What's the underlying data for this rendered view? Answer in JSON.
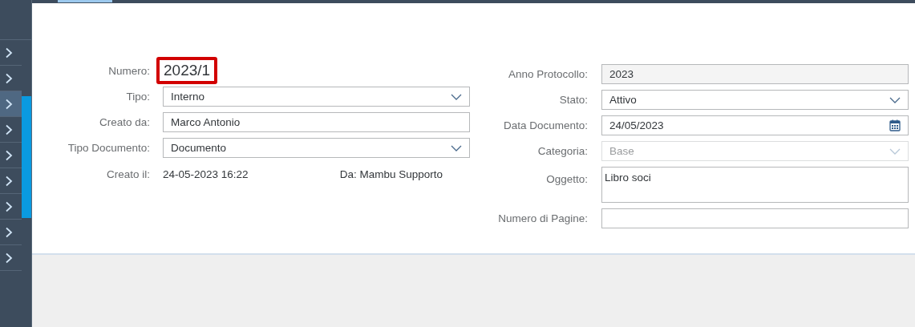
{
  "sidebar": {
    "items": [
      {
        "selected": false
      },
      {
        "selected": false
      },
      {
        "selected": true
      },
      {
        "selected": false
      },
      {
        "selected": false
      },
      {
        "selected": false
      },
      {
        "selected": false
      },
      {
        "selected": false
      },
      {
        "selected": false
      }
    ]
  },
  "form_left": [
    {
      "label": "Numero:",
      "kind": "number",
      "value": "2023/1",
      "highlighted": true
    },
    {
      "label": "Tipo:",
      "kind": "select",
      "value": "Interno"
    },
    {
      "label": "Creato da:",
      "kind": "text",
      "value": "Marco Antonio"
    },
    {
      "label": "Tipo Documento:",
      "kind": "select",
      "value": "Documento"
    },
    {
      "label": "Creato il:",
      "kind": "info",
      "value": "24-05-2023 16:22",
      "extra": "Da: Mambu Supporto"
    }
  ],
  "form_right": [
    {
      "label": "Anno Protocollo:",
      "kind": "readonly",
      "value": "2023"
    },
    {
      "label": "Stato:",
      "kind": "select",
      "value": "Attivo",
      "disabled": false
    },
    {
      "label": "Data Documento:",
      "kind": "date",
      "value": "24/05/2023"
    },
    {
      "label": "Categoria:",
      "kind": "select",
      "value": "Base",
      "disabled": true
    },
    {
      "label": "Oggetto:",
      "kind": "textarea",
      "value": "Libro soci"
    },
    {
      "label": "Numero di Pagine:",
      "kind": "text"
    }
  ]
}
